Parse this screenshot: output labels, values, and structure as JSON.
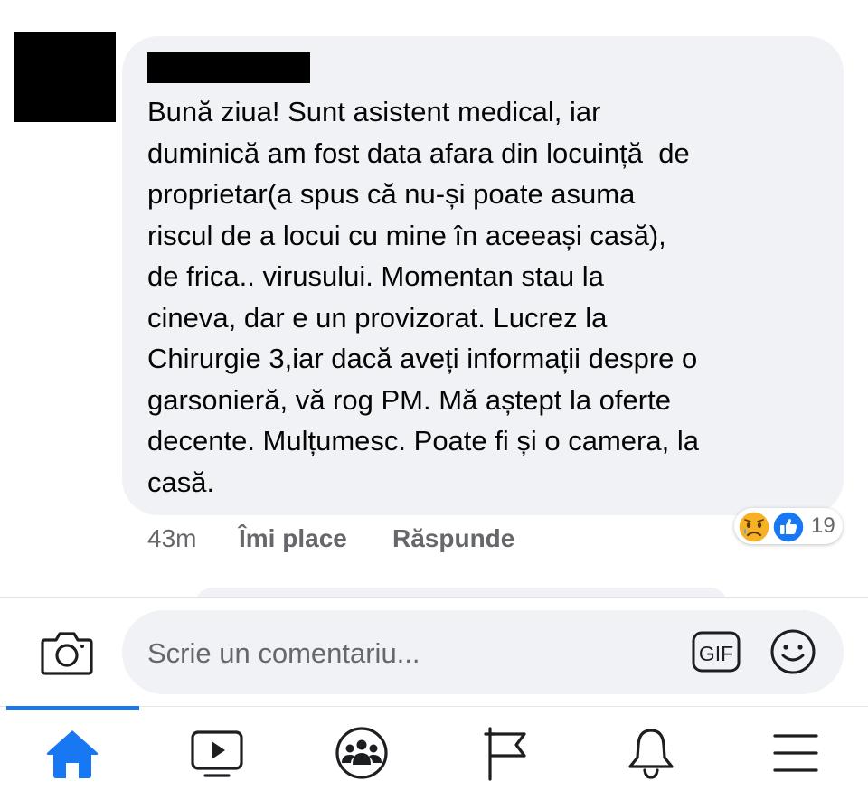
{
  "comment": {
    "lines": [
      "Bună ziua! Sunt asistent medical, iar",
      "duminică am fost data afara din locuință  de",
      "proprietar(a spus că nu-și poate asuma",
      "riscul de a locui cu mine în aceeași casă),",
      "de frica.. virusului. Momentan stau la",
      "cineva, dar e un provizorat. Lucrez la",
      "Chirurgie 3,iar dacă aveți informații despre o",
      "garsonieră, vă rog PM. Mă aștept la oferte",
      "decente. Mulțumesc. Poate fi și o camera, la",
      "casă."
    ],
    "time": "43m",
    "like_label": "Îmi place",
    "reply_label": "Răspunde",
    "reactions": {
      "icons": [
        "sad-emoji-icon",
        "like-thumb-icon"
      ],
      "count": "19"
    }
  },
  "composer": {
    "placeholder": "Scrie un comentariu...",
    "gif_label": "GIF",
    "icons": [
      "camera-icon",
      "gif-icon",
      "smile-icon"
    ]
  },
  "tabbar": {
    "items": [
      "home-icon",
      "video-icon",
      "groups-icon",
      "pages-flag-icon",
      "notifications-bell-icon",
      "menu-icon"
    ],
    "active": "home-icon",
    "accent": "#1877f2"
  },
  "colors": {
    "bubble": "#f0f2f5",
    "meta_text": "#65676b",
    "accent": "#1877f2"
  }
}
